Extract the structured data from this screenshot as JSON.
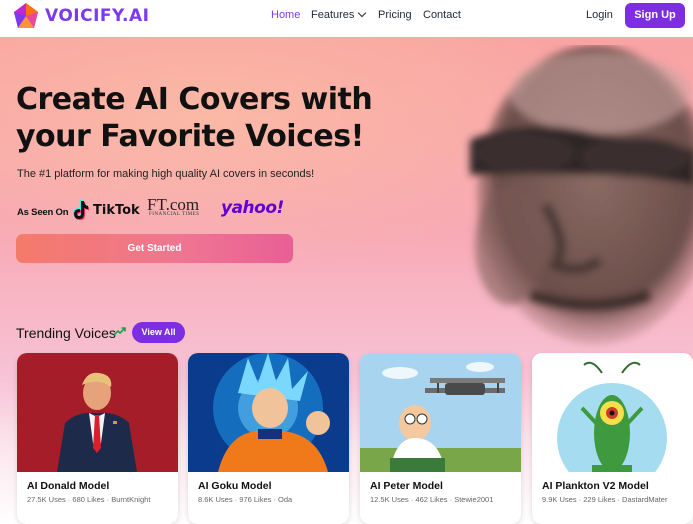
{
  "brand": {
    "name": "VOICIFY.AI",
    "accent": "#7c2ee0"
  },
  "nav": {
    "links": [
      "Home",
      "Features",
      "Pricing",
      "Contact"
    ],
    "login": "Login",
    "signup": "Sign Up"
  },
  "hero": {
    "headline_line1": "Create AI Covers with",
    "headline_line2": "your Favorite Voices!",
    "subtitle": "The #1 platform for making high quality AI covers in seconds!",
    "seen_on_label": "As Seen On",
    "press": {
      "tiktok": "TikTok",
      "ft": "FT.com",
      "ft_sub": "FINANCIAL TIMES",
      "yahoo": "yahoo!"
    },
    "cta": "Get Started"
  },
  "trending": {
    "title": "Trending Voices",
    "view_all": "View All",
    "cards": [
      {
        "title": "AI Donald Model",
        "meta": "27.5K Uses · 680 Likes · BurntKnight"
      },
      {
        "title": "AI Goku Model",
        "meta": "8.6K Uses · 976 Likes · Oda"
      },
      {
        "title": "AI Peter Model",
        "meta": "12.5K Uses · 462 Likes · Stewie2001"
      },
      {
        "title": "AI Plankton V2 Model",
        "meta": "9.9K Uses · 229 Likes · DastardMater"
      }
    ]
  }
}
